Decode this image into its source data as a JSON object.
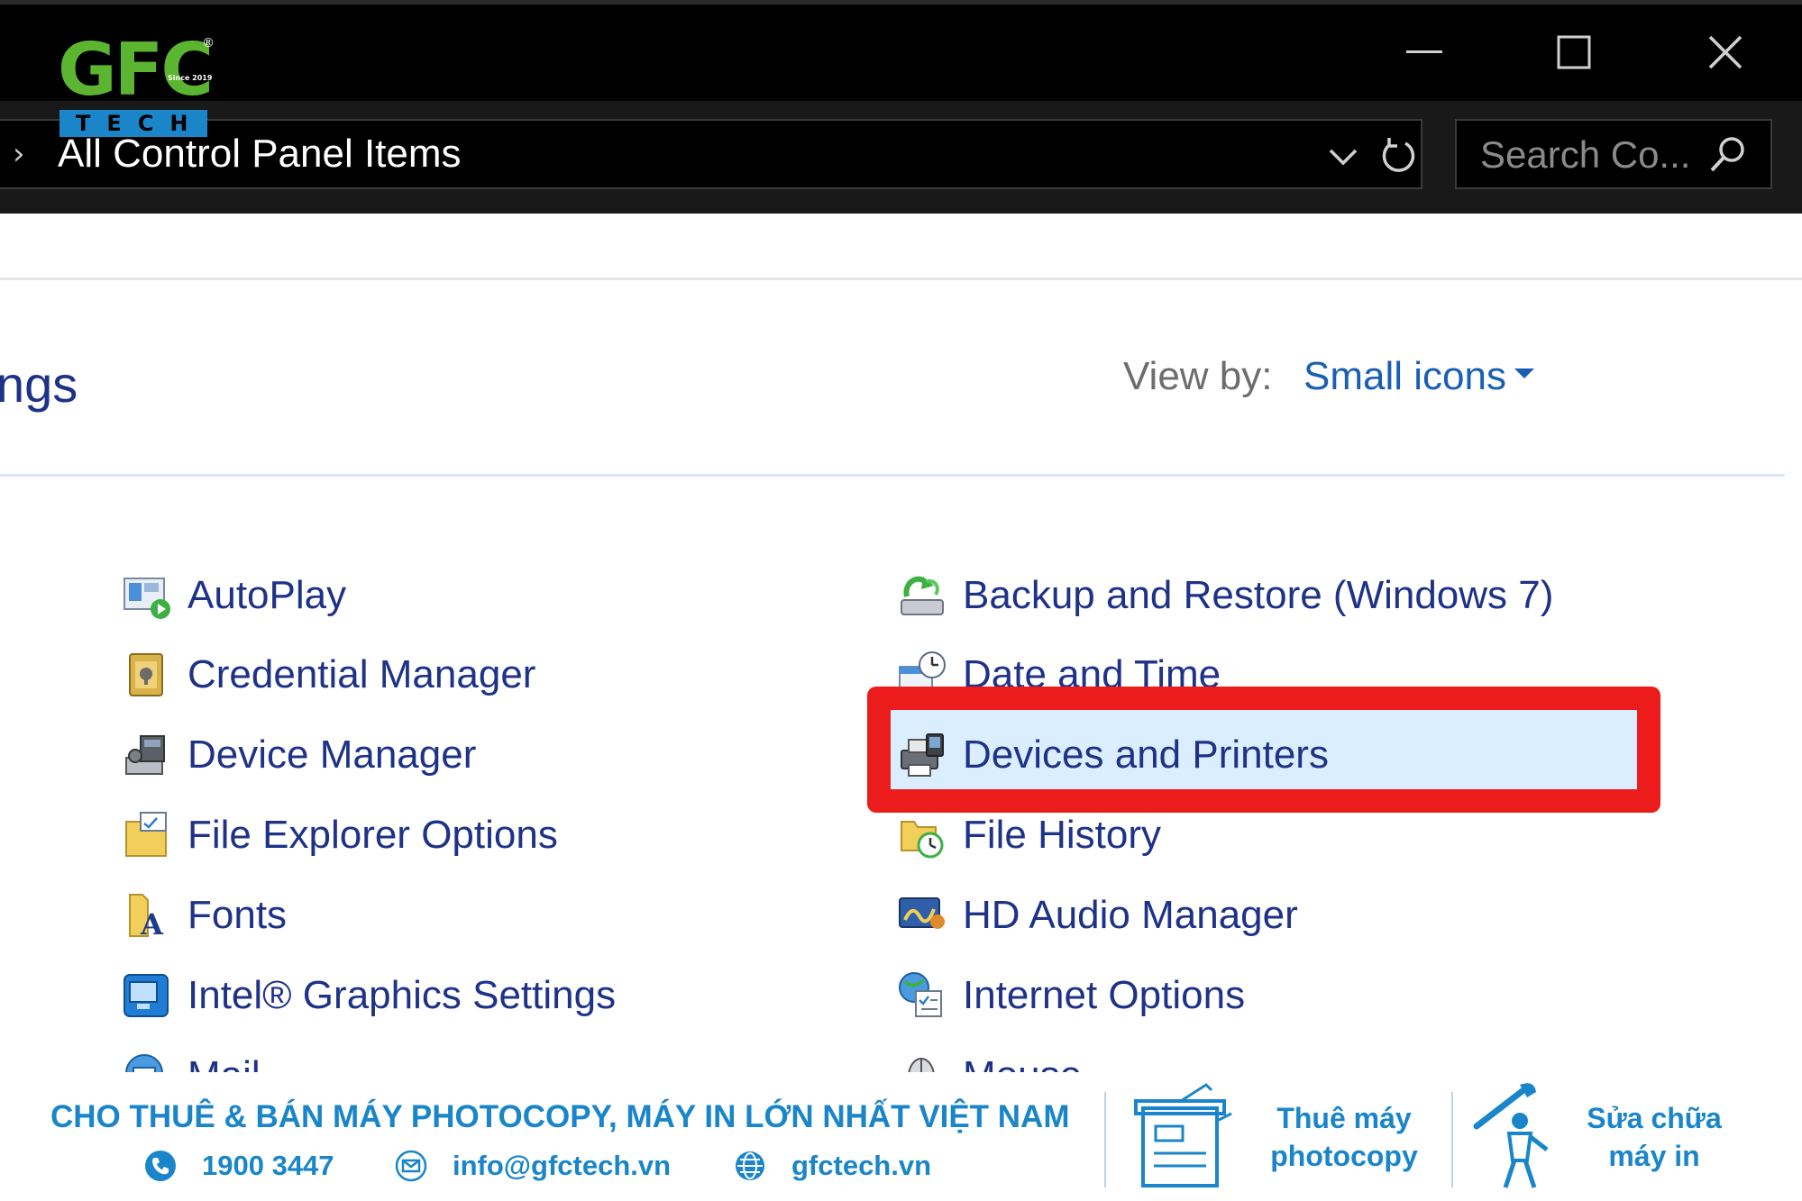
{
  "logo": {
    "main": "GFC",
    "sub": "TECH",
    "since": "Since 2019",
    "registered": "®"
  },
  "address_bar": {
    "chevron": "›",
    "path": "All Control Panel Items"
  },
  "search": {
    "placeholder": "Search Co..."
  },
  "header": {
    "heading_fragment": "ngs",
    "view_by_label": "View by:",
    "view_by_value": "Small icons"
  },
  "items": [
    {
      "label": "AutoPlay",
      "icon": "autoplay-icon"
    },
    {
      "label": "Backup and Restore (Windows 7)",
      "icon": "backup-restore-icon"
    },
    {
      "label": "Credential Manager",
      "icon": "credential-manager-icon"
    },
    {
      "label": "Date and Time",
      "icon": "date-time-icon"
    },
    {
      "label": "Device Manager",
      "icon": "device-manager-icon"
    },
    {
      "label": "Devices and Printers",
      "icon": "devices-printers-icon",
      "highlighted": true
    },
    {
      "label": "File Explorer Options",
      "icon": "file-explorer-options-icon"
    },
    {
      "label": "File History",
      "icon": "file-history-icon"
    },
    {
      "label": "Fonts",
      "icon": "fonts-icon"
    },
    {
      "label": "HD Audio Manager",
      "icon": "hd-audio-icon"
    },
    {
      "label": "Intel® Graphics Settings",
      "icon": "intel-graphics-icon"
    },
    {
      "label": "Internet Options",
      "icon": "internet-options-icon"
    },
    {
      "label": "Mail",
      "icon": "mail-icon"
    },
    {
      "label": "Mouse",
      "icon": "mouse-icon"
    }
  ],
  "banner": {
    "slogan": "CHO THUÊ & BÁN MÁY PHOTOCOPY, MÁY IN LỚN NHẤT VIỆT NAM",
    "phone": "1900 3447",
    "email": "info@gfctech.vn",
    "website": "gfctech.vn",
    "service1": [
      "Thuê máy",
      "photocopy"
    ],
    "service2": [
      "Sửa chữa",
      "máy in"
    ]
  },
  "colors": {
    "link": "#1e3287",
    "accent_blue": "#1a86c9",
    "highlight": "#dbeeff",
    "annotation_red": "#ed1c1c",
    "logo_green": "#5cb531"
  }
}
